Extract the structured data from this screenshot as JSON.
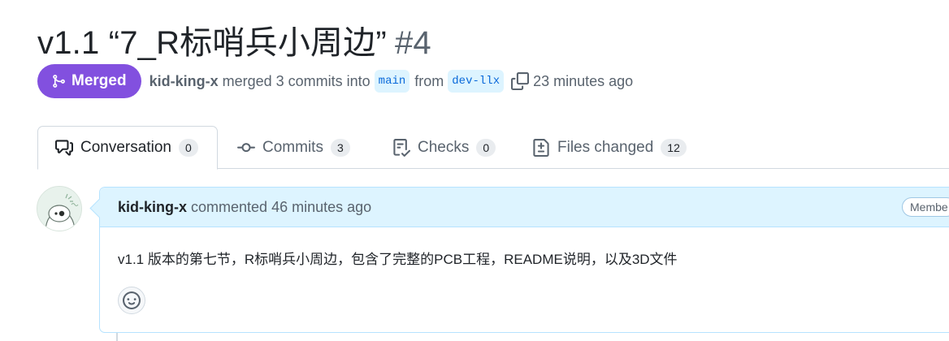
{
  "pr": {
    "title": "v1.1 “7_R标哨兵小周边”",
    "number": "#4",
    "status": "Merged",
    "author": "kid-king-x",
    "merged_text": "merged 3 commits into",
    "base_branch": "main",
    "from_text": "from",
    "head_branch": "dev-llx",
    "time_ago": "23 minutes ago"
  },
  "tabs": [
    {
      "label": "Conversation",
      "count": "0",
      "icon": "comment-discussion-icon"
    },
    {
      "label": "Commits",
      "count": "3",
      "icon": "git-commit-icon"
    },
    {
      "label": "Checks",
      "count": "0",
      "icon": "checklist-icon"
    },
    {
      "label": "Files changed",
      "count": "12",
      "icon": "file-diff-icon"
    }
  ],
  "comment": {
    "author": "kid-king-x",
    "action": "commented",
    "time_ago": "46 minutes ago",
    "role": "Membe",
    "body": "v1.1 版本的第七节，R标哨兵小周边，包含了完整的PCB工程，README说明，以及3D文件"
  },
  "colors": {
    "merged_purple": "#8250df",
    "branch_bg": "#ddf4ff",
    "branch_fg": "#0969da",
    "comment_header_bg": "#ddf4ff",
    "comment_border": "#b6e3ff"
  }
}
